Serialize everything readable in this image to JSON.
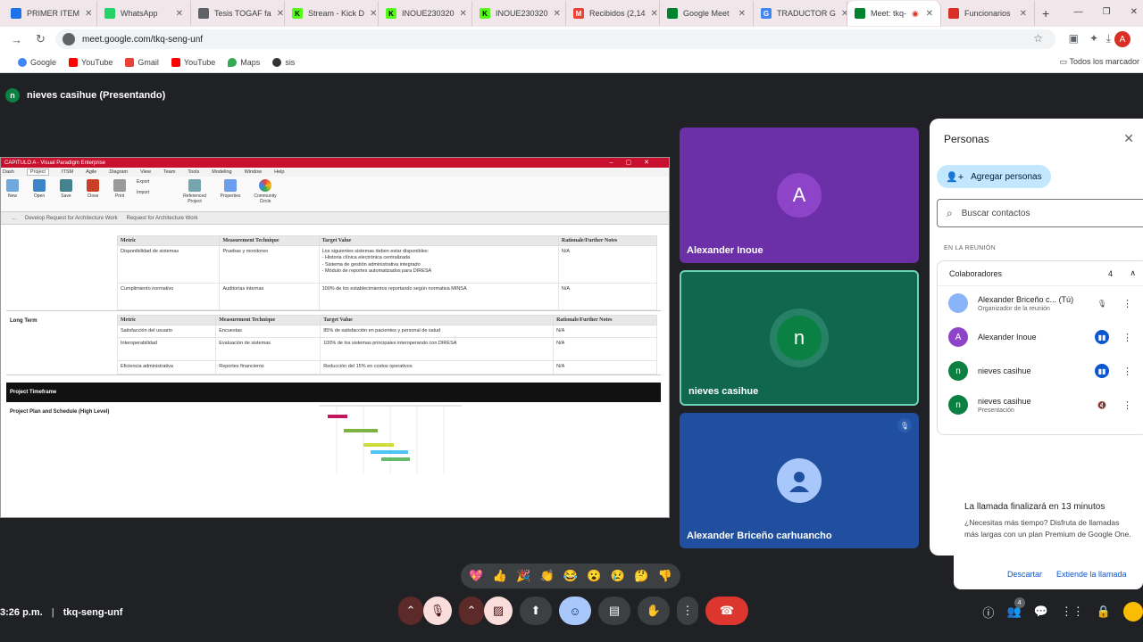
{
  "browser": {
    "tabs": [
      {
        "label": "PRIMER ITEM",
        "color": "#1a73e8"
      },
      {
        "label": "WhatsApp",
        "color": "#25d366"
      },
      {
        "label": "Tesis TOGAF fa",
        "color": "#5f6368"
      },
      {
        "label": "Stream - Kick D",
        "color": "#53fc18"
      },
      {
        "label": "INOUE230320",
        "color": "#53fc18"
      },
      {
        "label": "INOUE230320",
        "color": "#53fc18"
      },
      {
        "label": "Recibidos (2,14",
        "color": "#ea4335"
      },
      {
        "label": "Google Meet",
        "color": "#00832d"
      },
      {
        "label": "TRADUCTOR G",
        "color": "#4285f4"
      },
      {
        "label": "Meet: tkq-",
        "color": "#00832d"
      },
      {
        "label": "Funcionarios",
        "color": "#d93025"
      }
    ],
    "new_tab": "+",
    "url": "meet.google.com/tkq-seng-unf",
    "profile_initial": "A",
    "bookmarks": [
      {
        "label": "Google",
        "color": "#4285f4"
      },
      {
        "label": "YouTube",
        "color": "#ff0000"
      },
      {
        "label": "Gmail",
        "color": "#ea4335"
      },
      {
        "label": "YouTube",
        "color": "#ff0000"
      },
      {
        "label": "Maps",
        "color": "#34a853"
      },
      {
        "label": "sis",
        "color": "#333333"
      }
    ],
    "all_bookmarks": "Todos los marcador"
  },
  "meet": {
    "presenter_initial": "n",
    "presenter_label": "nieves casihue (Presentando)",
    "shared": {
      "title": "CAPITULO A - Visual Paradigm Enterprise",
      "menu": [
        "Dash",
        "Project",
        "ITSM",
        "Agile",
        "Diagram",
        "View",
        "Team",
        "Tools",
        "Modeling",
        "Window",
        "Help"
      ],
      "ribbon": [
        "New",
        "Open",
        "Save",
        "Close",
        "Print",
        "Export",
        "Import",
        "Referenced Project",
        "Properties",
        "Community Circle"
      ],
      "breadcrumbs": [
        "...",
        "Develop Request for Architecture Work",
        "Request for Architecture Work"
      ],
      "headers": [
        "Metric",
        "Measurement Technique",
        "Target Value",
        "Rationale/Further Notes"
      ],
      "short_rows": [
        [
          "Disponibilidad de sistemas",
          "Pruebas y monitoreo",
          "Los siguientes sistemas deben estar disponibles:\n- Historia clínica electrónica centralizada\n- Sistema de gestión administrativa integrado\n- Módulo de reportes automatizados para DIRESA",
          "N/A"
        ],
        [
          "Cumplimiento normativo",
          "Auditorías internas",
          "100% de los establecimientos reportando según normativa MINSA",
          "N/A"
        ]
      ],
      "long_term_label": "Long Term",
      "long_rows": [
        [
          "Satisfacción del usuario",
          "Encuestas",
          "85% de satisfacción en pacientes y personal de salud",
          "N/A"
        ],
        [
          "Interoperabilidad",
          "Evaluación de sistemas",
          "100% de los sistemas principales interoperando con DIRESA",
          "N/A"
        ],
        [
          "Eficiencia administrativa",
          "Reportes financieros",
          "Reducción del 15% en costos operativos",
          "N/A"
        ]
      ],
      "timeframe_label": "Project Timeframe",
      "plan_label": "Project Plan and Schedule (High Level)"
    },
    "tiles": [
      {
        "name": "Alexander Inoue",
        "initial": "A",
        "bg": "#6b2fa8",
        "avatar": "#8e44c9"
      },
      {
        "name": "nieves casihue",
        "initial": "n",
        "bg": "#11664e",
        "avatar": "#0b8043"
      },
      {
        "name": "Alexander Briceño carhuancho",
        "initial": "",
        "bg": "#1f4f9e",
        "avatar": "#a8c7fa"
      }
    ],
    "people": {
      "title": "Personas",
      "add": "Agregar personas",
      "search_placeholder": "Buscar contactos",
      "in_meeting": "EN LA REUNIÓN",
      "group": "Colaboradores",
      "count": "4",
      "list": [
        {
          "name": "Alexander Briceño c...",
          "tag": "(Tú)",
          "sub": "Organizador de la reunión",
          "initial": "",
          "color": "#8ab4f8"
        },
        {
          "name": "Alexander Inoue",
          "tag": "",
          "sub": "",
          "initial": "A",
          "color": "#8e44c9"
        },
        {
          "name": "nieves casihue",
          "tag": "",
          "sub": "",
          "initial": "n",
          "color": "#0b8043"
        },
        {
          "name": "nieves casihue",
          "tag": "",
          "sub": "Presentación",
          "initial": "n",
          "color": "#0b8043"
        }
      ]
    },
    "toast": {
      "title": "La llamada finalizará en 13 minutos",
      "body": "¿Necesitas más tiempo? Disfruta de llamadas más largas con un plan Premium de Google One.",
      "dismiss": "Descartar",
      "extend": "Extiende la llamada"
    },
    "reactions": [
      "💖",
      "👍",
      "🎉",
      "👏",
      "😂",
      "😮",
      "😢",
      "🤔",
      "👎"
    ],
    "time": "3:26 p.m.",
    "code": "tkq-seng-unf",
    "people_badge": "4"
  }
}
